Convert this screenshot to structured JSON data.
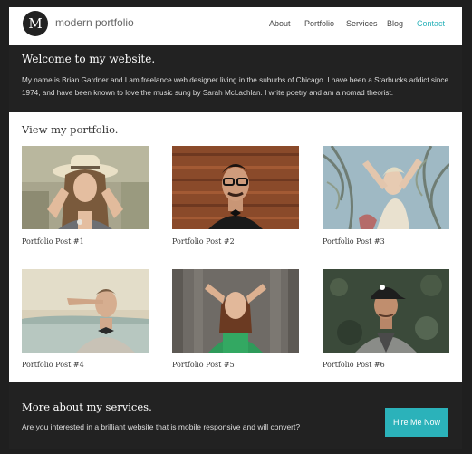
{
  "header": {
    "logo_letter": "M",
    "site_name": "modern portfolio",
    "nav": [
      {
        "label": "About",
        "active": false
      },
      {
        "label": "Portfolio",
        "active": false
      },
      {
        "label": "Services",
        "active": false
      },
      {
        "label": "Blog",
        "active": false
      },
      {
        "label": "Contact",
        "active": true
      }
    ]
  },
  "welcome": {
    "title": "Welcome to my website.",
    "body": "My name is Brian Gardner and I am freelance web designer living in the suburbs of Chicago. I have been a Starbucks addict since 1974, and have been known to love the music sung by Sarah McLachlan. I write poetry and am a nomad theorist."
  },
  "portfolio": {
    "title": "View my portfolio.",
    "posts": [
      {
        "caption": "Portfolio Post #1"
      },
      {
        "caption": "Portfolio Post #2"
      },
      {
        "caption": "Portfolio Post #3"
      },
      {
        "caption": "Portfolio Post #4"
      },
      {
        "caption": "Portfolio Post #5"
      },
      {
        "caption": "Portfolio Post #6"
      }
    ]
  },
  "services": {
    "title": "More about my services.",
    "body": "Are you interested in a brilliant website that is mobile responsive and will convert?",
    "button_label": "Hire Me Now"
  },
  "colors": {
    "accent": "#2bb2ba",
    "dark_band": "#222222",
    "background": "#1f1f1f"
  }
}
